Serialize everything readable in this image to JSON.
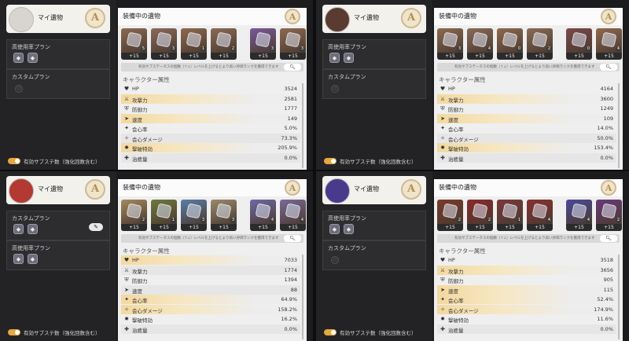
{
  "colors": {
    "accent": "#e6a640",
    "badge": "#b48f4c",
    "highlight": "#f3d9a0"
  },
  "ui": {
    "char_title": "マイ遺物",
    "rank": "A",
    "equipped_title": "装備中の遺物",
    "plan_high": "高使用率プラン",
    "plan_custom": "カスタムプラン",
    "search_text": "有効サブステータスの個数（↑↓）レベルを上げるとより高い評価ランクを獲得できます",
    "search_icon": "search-icon",
    "stats_title": "キャラクター属性",
    "toggle_label": "有効サブステ数（強化回数含む）",
    "stat_names": [
      "HP",
      "攻撃力",
      "防御力",
      "速度",
      "会心率",
      "会心ダメージ",
      "撃破特効",
      "治癒量"
    ],
    "stat_icons": [
      "heart-icon",
      "sword-icon",
      "shield-icon",
      "speed-icon",
      "crit-rate-icon",
      "crit-dmg-icon",
      "break-icon",
      "heal-icon"
    ]
  },
  "panels": [
    {
      "name": "panel-top-left",
      "avatar_color": "#d8d4cf",
      "plans": [
        {
          "title": "高使用率プラン",
          "icons": 2,
          "empty": false,
          "edit": false
        },
        {
          "title": "カスタムプラン",
          "icons": 0,
          "empty": true,
          "edit": false
        }
      ],
      "relics": [
        {
          "color": "#8e6a52",
          "level": "5",
          "plus": "+15"
        },
        {
          "color": "#8a6c5a",
          "level": "3",
          "plus": "+15"
        },
        {
          "color": "#8f6a4f",
          "level": "1",
          "plus": "+15"
        },
        {
          "color": "#8b6b55",
          "level": "2",
          "plus": "+15"
        },
        {
          "color": "#7a5a9a",
          "level": "3",
          "plus": "+15"
        },
        {
          "color": "#8f6a4f",
          "level": "3",
          "plus": "+15"
        }
      ],
      "stats": [
        "3524",
        "2581",
        "1777",
        "149",
        "5.0%",
        "73.3%",
        "205.9%",
        "0.0%"
      ],
      "highlights": [
        1,
        3,
        6
      ]
    },
    {
      "name": "panel-top-right",
      "avatar_color": "#5a3b30",
      "plans": [
        {
          "title": "高使用率プラン",
          "icons": 2,
          "empty": false,
          "edit": false
        },
        {
          "title": "カスタムプラン",
          "icons": 0,
          "empty": true,
          "edit": false
        }
      ],
      "relics": [
        {
          "color": "#8e6a52",
          "level": "3",
          "plus": "+15"
        },
        {
          "color": "#8a6c5a",
          "level": "4",
          "plus": "+15"
        },
        {
          "color": "#8f6a4f",
          "level": "0",
          "plus": "+15"
        },
        {
          "color": "#8b6b55",
          "level": "2",
          "plus": "+15"
        },
        {
          "color": "#7a4a4a",
          "level": "0",
          "plus": "+15"
        },
        {
          "color": "#8f6a4f",
          "level": "4",
          "plus": "+15"
        }
      ],
      "stats": [
        "4164",
        "3600",
        "1249",
        "109",
        "14.0%",
        "50.0%",
        "153.4%",
        "0.0%"
      ],
      "highlights": [
        1,
        3,
        6
      ]
    },
    {
      "name": "panel-bottom-left",
      "avatar_color": "#b23a32",
      "plans": [
        {
          "title": "カスタムプラン",
          "icons": 2,
          "empty": false,
          "edit": true
        },
        {
          "title": "高使用率プラン",
          "icons": 2,
          "empty": false,
          "edit": false
        }
      ],
      "relics": [
        {
          "color": "#a58a5e",
          "level": "2",
          "plus": "+15"
        },
        {
          "color": "#6f7a3e",
          "level": "1",
          "plus": "+15"
        },
        {
          "color": "#5a7ea8",
          "level": "3",
          "plus": "+15"
        },
        {
          "color": "#9a8c6c",
          "level": "3",
          "plus": "+15"
        },
        {
          "color": "#6e6aa6",
          "level": "4",
          "plus": "+15"
        },
        {
          "color": "#7a6a9a",
          "level": "4",
          "plus": "+15"
        }
      ],
      "stats": [
        "7033",
        "1774",
        "1394",
        "88",
        "64.9%",
        "158.2%",
        "16.2%",
        "0.0%"
      ],
      "highlights": [
        0,
        4,
        5
      ]
    },
    {
      "name": "panel-bottom-right",
      "avatar_color": "#4a3a8c",
      "plans": [
        {
          "title": "高使用率プラン",
          "icons": 2,
          "empty": false,
          "edit": false
        },
        {
          "title": "カスタムプラン",
          "icons": 0,
          "empty": true,
          "edit": false
        }
      ],
      "relics": [
        {
          "color": "#7a3a2a",
          "level": "2",
          "plus": "+15"
        },
        {
          "color": "#8a2a2a",
          "level": "2",
          "plus": "+15"
        },
        {
          "color": "#7a3a3a",
          "level": "1",
          "plus": "+15"
        },
        {
          "color": "#8a3030",
          "level": "4",
          "plus": "+15"
        },
        {
          "color": "#4a4a9a",
          "level": "4",
          "plus": "+15"
        },
        {
          "color": "#6a3a7a",
          "level": "2",
          "plus": "+15"
        }
      ],
      "stats": [
        "3518",
        "3656",
        "905",
        "115",
        "52.4%",
        "174.9%",
        "11.6%",
        "0.0%"
      ],
      "highlights": [
        1,
        3,
        4,
        5
      ]
    }
  ]
}
